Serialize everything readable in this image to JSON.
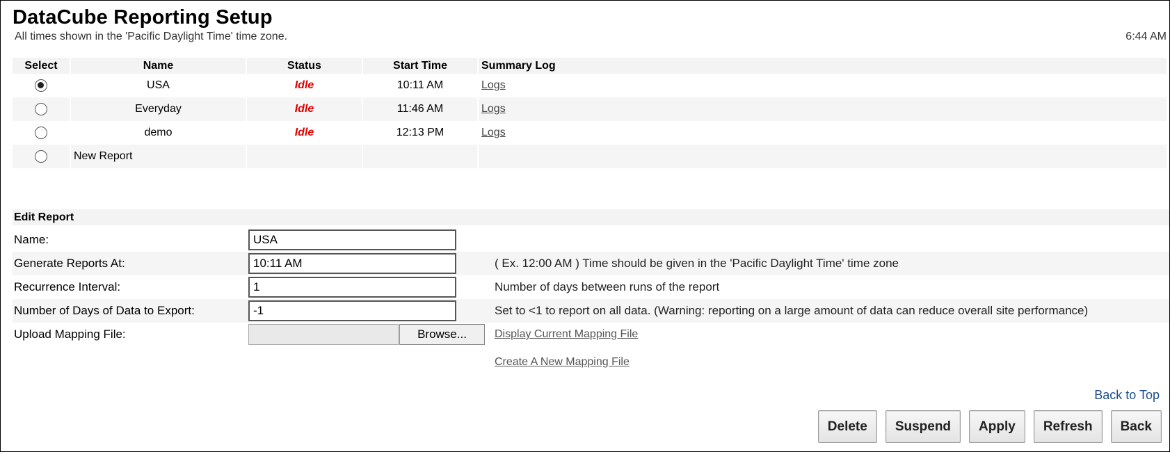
{
  "header": {
    "title": "DataCube Reporting Setup",
    "timezone_note": "All times shown in the 'Pacific Daylight Time' time zone.",
    "current_time": "6:44 AM"
  },
  "reports_table": {
    "columns": [
      "Select",
      "Name",
      "Status",
      "Start Time",
      "Summary Log"
    ],
    "rows": [
      {
        "name": "USA",
        "status": "Idle",
        "start_time": "10:11 AM",
        "log": "Logs",
        "selected": true
      },
      {
        "name": "Everyday",
        "status": "Idle",
        "start_time": "11:46 AM",
        "log": "Logs",
        "selected": false
      },
      {
        "name": "demo",
        "status": "Idle",
        "start_time": "12:13 PM",
        "log": "Logs",
        "selected": false
      }
    ],
    "new_report_label": "New Report"
  },
  "edit_report": {
    "heading": "Edit Report",
    "name": {
      "label": "Name:",
      "value": "USA"
    },
    "generate_at": {
      "label": "Generate Reports At:",
      "value": "10:11 AM",
      "hint": "( Ex. 12:00 AM ) Time should be given in the 'Pacific Daylight Time' time zone"
    },
    "recurrence": {
      "label": "Recurrence Interval:",
      "value": "1",
      "hint": "Number of days between runs of the report"
    },
    "days_export": {
      "label": "Number of Days of Data to Export:",
      "value": "-1",
      "hint": "Set to <1 to report on all data. (Warning: reporting on a large amount of data can reduce overall site performance)"
    },
    "upload": {
      "label": "Upload Mapping File:",
      "browse_label": "Browse...",
      "display_link": "Display Current Mapping File",
      "create_link": "Create A New Mapping File"
    }
  },
  "back_to_top": "Back to Top",
  "actions": {
    "delete": "Delete",
    "suspend": "Suspend",
    "apply": "Apply",
    "refresh": "Refresh",
    "back": "Back"
  },
  "colors": {
    "status_idle": "#e00000",
    "row_alt": "#f5f5f5",
    "link_blue": "#1e4e8c"
  }
}
